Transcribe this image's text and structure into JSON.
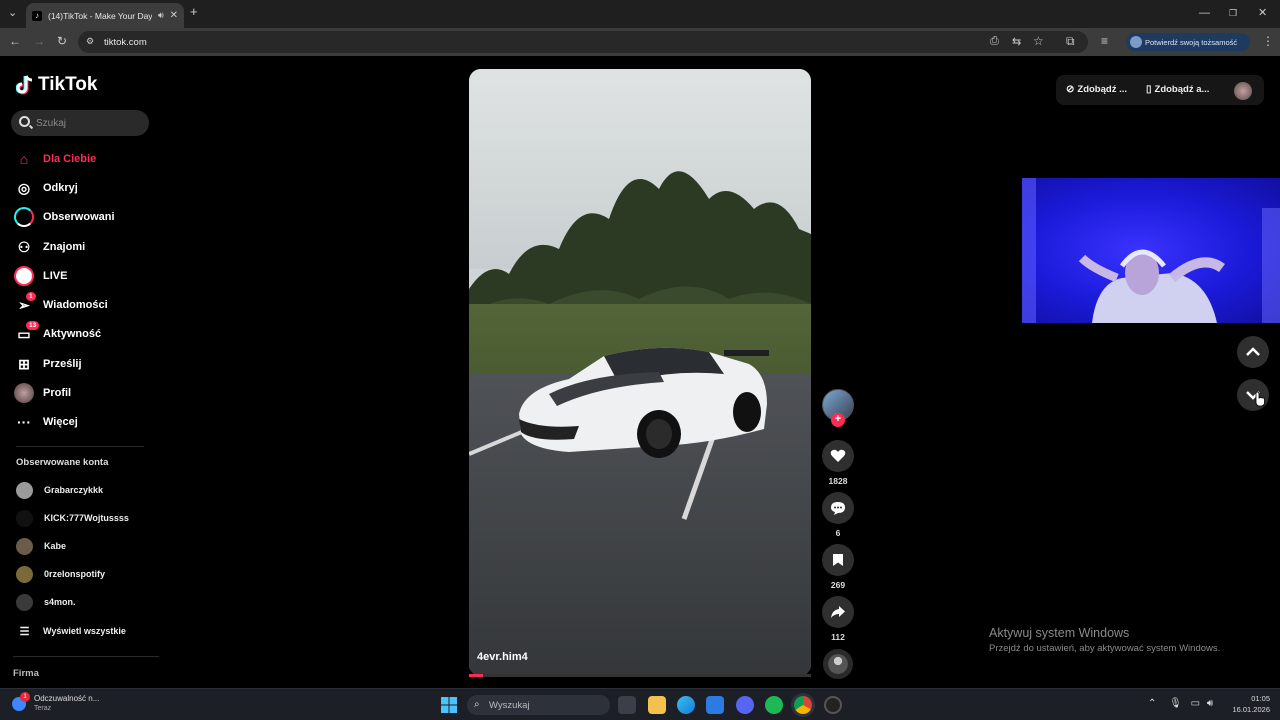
{
  "browser": {
    "tab_title": "(14)TikTok - Make Your Day",
    "url": "tiktok.com",
    "verify_label": "Potwierdź swoją tożsamość"
  },
  "tiktok": {
    "logo": "TikTok",
    "search_placeholder": "Szukaj",
    "nav": [
      {
        "label": "Dla Ciebie",
        "icon": "home-icon",
        "active": true
      },
      {
        "label": "Odkryj",
        "icon": "compass-icon"
      },
      {
        "label": "Obserwowani",
        "icon": "following-ring-icon"
      },
      {
        "label": "Znajomi",
        "icon": "friends-icon"
      },
      {
        "label": "LIVE",
        "icon": "live-icon"
      },
      {
        "label": "Wiadomości",
        "icon": "messages-icon",
        "badge": "1"
      },
      {
        "label": "Aktywność",
        "icon": "activity-icon",
        "badge": "13"
      },
      {
        "label": "Prześlij",
        "icon": "upload-icon"
      },
      {
        "label": "Profil",
        "icon": "profile-avatar"
      },
      {
        "label": "Więcej",
        "icon": "more-icon"
      }
    ],
    "followed_title": "Obserwowane konta",
    "followed": [
      {
        "name": "Grabarczykkk",
        "color": "#9a9a9a"
      },
      {
        "name": "KICK:777Wojtussss",
        "color": "#111111"
      },
      {
        "name": "Kabe",
        "color": "#6b5b4b"
      },
      {
        "name": "0rzelonspotify",
        "color": "#7a6a3a"
      },
      {
        "name": "s4mon.",
        "color": "#3a3a3a"
      }
    ],
    "show_all": "Wyświetl wszystkie",
    "company": "Firma",
    "video_author": "4evr.him4",
    "likes": "1828",
    "comments": "6",
    "saves": "269",
    "shares": "112",
    "top_right": {
      "item1": "Zdobądź ...",
      "item2": "Zdobądź a..."
    },
    "progress": 0.04
  },
  "watermark": {
    "title": "Aktywuj system Windows",
    "subtitle": "Przejdź do ustawień, aby aktywować system Windows."
  },
  "taskbar": {
    "notif_title": "Odczuwalność n...",
    "notif_sub": "Teraz",
    "notif_badge": "1",
    "search": "Wyszukaj",
    "time": "01:05",
    "date": "16.01.2026"
  },
  "colors": {
    "accent": "#fe2c55",
    "cam_blue": "#2626ff"
  }
}
